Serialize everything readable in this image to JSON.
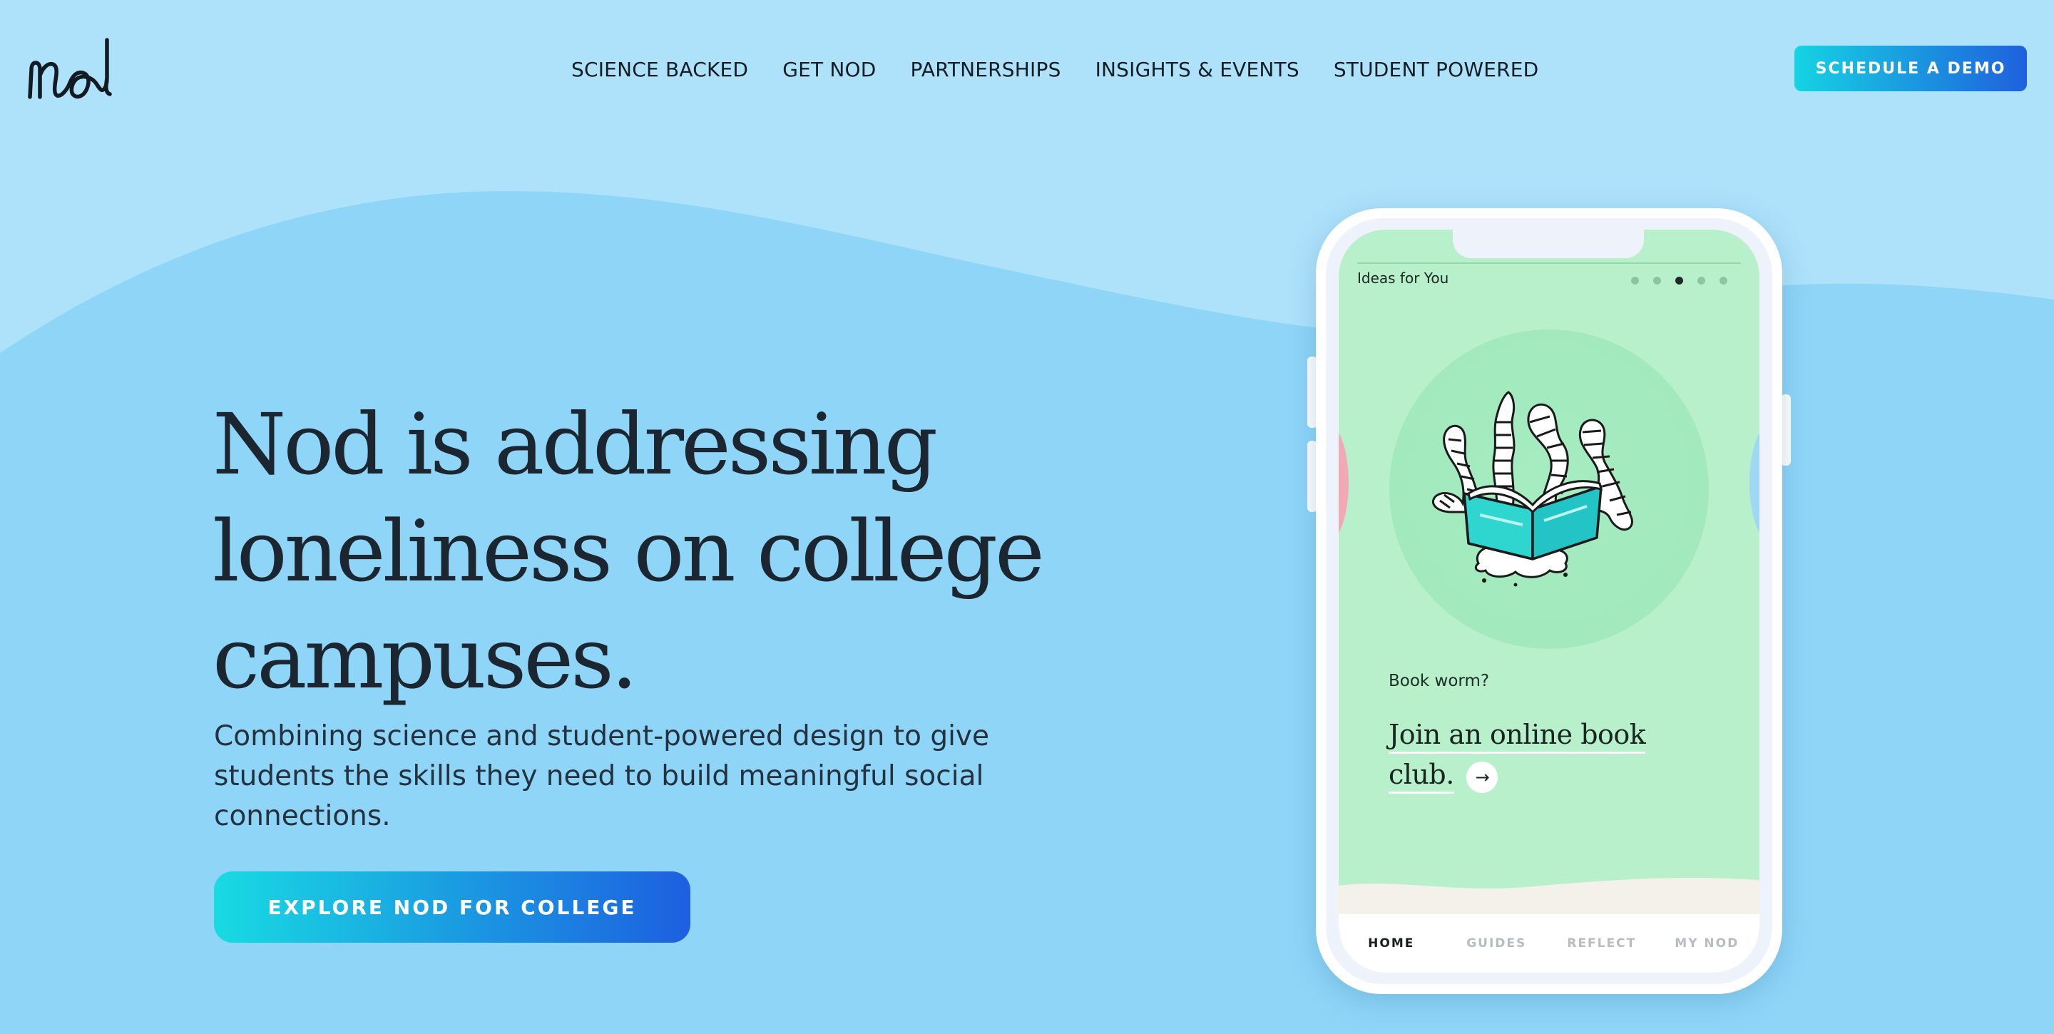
{
  "brand": {
    "logo_text": "nod"
  },
  "nav": {
    "items": [
      {
        "label": "SCIENCE BACKED"
      },
      {
        "label": "GET NOD"
      },
      {
        "label": "PARTNERSHIPS"
      },
      {
        "label": "INSIGHTS & EVENTS"
      },
      {
        "label": "STUDENT POWERED"
      }
    ],
    "cta_label": "SCHEDULE A DEMO"
  },
  "hero": {
    "title": "Nod is addressing loneliness on college campuses.",
    "subtitle": "Combining science and student-powered design to give students the skills they need to build meaningful social connections.",
    "cta_label": "EXPLORE NOD FOR COLLEGE"
  },
  "phone": {
    "section_label": "Ideas for You",
    "carousel": {
      "count": 5,
      "active_index": 2
    },
    "card": {
      "illustration": "book-worm-illustration",
      "eyebrow": "Book worm?",
      "title": "Join an online book club.",
      "action_icon": "arrow-right-icon"
    },
    "tabs": [
      {
        "label": "HOME",
        "active": true
      },
      {
        "label": "GUIDES",
        "active": false
      },
      {
        "label": "REFLECT",
        "active": false
      },
      {
        "label": "MY NOD",
        "active": false
      }
    ]
  },
  "colors": {
    "background_light": "#aee2fb",
    "background_wave": "#8fd5f8",
    "accent_gradient_start": "#16d3e3",
    "accent_gradient_end": "#1f60dd",
    "phone_screen": "#b8f0cc",
    "text_dark": "#1b2630"
  }
}
